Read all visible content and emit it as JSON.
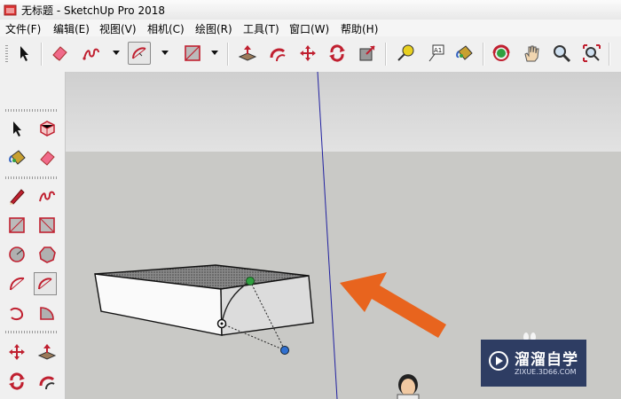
{
  "window": {
    "title": "无标题 - SketchUp Pro 2018"
  },
  "menu": [
    "文件(F)",
    "编辑(E)",
    "视图(V)",
    "相机(C)",
    "绘图(R)",
    "工具(T)",
    "窗口(W)",
    "帮助(H)"
  ],
  "toolbar": {
    "tools": [
      "select-tool",
      "eraser-tool",
      "freehand-tool",
      "arc-tool",
      "rectangle-tool",
      "push-pull-tool",
      "follow-me-tool",
      "move-tool",
      "rotate-tool",
      "scale-tool",
      "tape-measure-tool",
      "text-tool",
      "paint-bucket-tool",
      "orbit-tool",
      "pan-tool",
      "zoom-tool",
      "zoom-extents-tool"
    ],
    "text_tool_label": "A1",
    "active": "arc-tool"
  },
  "left_toolbar": {
    "active": "two-point-arc-tool"
  },
  "colors": {
    "sky": "#d8d8d8",
    "ground": "#c8c8c5",
    "axis_blue": "#2020a0",
    "arrow": "#e8641e",
    "watermark_bg": "#2e3d63"
  },
  "watermark": {
    "name": "溜溜自学",
    "url": "ZIXUE.3D66.COM"
  }
}
